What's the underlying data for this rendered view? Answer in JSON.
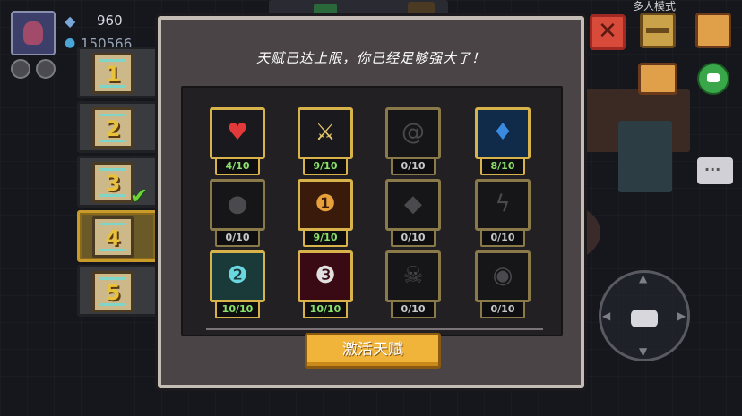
{
  "hud": {
    "gems": "960",
    "coins": "150566",
    "mode_label": "多人模式"
  },
  "tabs": [
    {
      "label": "1",
      "active": false,
      "completed": false
    },
    {
      "label": "2",
      "active": false,
      "completed": false
    },
    {
      "label": "3",
      "active": false,
      "completed": true
    },
    {
      "label": "4",
      "active": true,
      "completed": false
    },
    {
      "label": "5",
      "active": false,
      "completed": false
    }
  ],
  "dialog": {
    "title": "天赋已达上限，你已经足够强大了！",
    "activate_label": "激活天赋"
  },
  "talents": [
    {
      "level": "4/10",
      "icon": "heart-icon",
      "locked": false,
      "color": "#e23a3a"
    },
    {
      "level": "9/10",
      "icon": "sword-icon",
      "locked": false,
      "color": "#e8c86a"
    },
    {
      "level": "0/10",
      "icon": "swirl-icon",
      "locked": true,
      "color": "#5a5a5e"
    },
    {
      "level": "8/10",
      "icon": "blue-flame-icon",
      "locked": false,
      "color": "#3a8ae0"
    },
    {
      "level": "0/10",
      "icon": "bomb-icon",
      "locked": true,
      "color": "#5a5a5e"
    },
    {
      "level": "9/10",
      "icon": "magnifier-1-icon",
      "locked": false,
      "color": "#e8a03a"
    },
    {
      "level": "0/10",
      "icon": "shield-icon",
      "locked": true,
      "color": "#5a5a5e"
    },
    {
      "level": "0/10",
      "icon": "lightning-icon",
      "locked": true,
      "color": "#5a5a5e"
    },
    {
      "level": "10/10",
      "icon": "magnifier-2-icon",
      "locked": false,
      "color": "#6ad6e0"
    },
    {
      "level": "10/10",
      "icon": "magnifier-3-icon",
      "locked": false,
      "color": "#e0e0e0"
    },
    {
      "level": "0/10",
      "icon": "skull-icon",
      "locked": true,
      "color": "#5a5a5e"
    },
    {
      "level": "0/10",
      "icon": "eye-icon",
      "locked": true,
      "color": "#5a5a5e"
    }
  ],
  "colors": {
    "accent": "#f0b43a",
    "frame_gold": "#d8b24a",
    "level_text": "#8ae06a"
  }
}
